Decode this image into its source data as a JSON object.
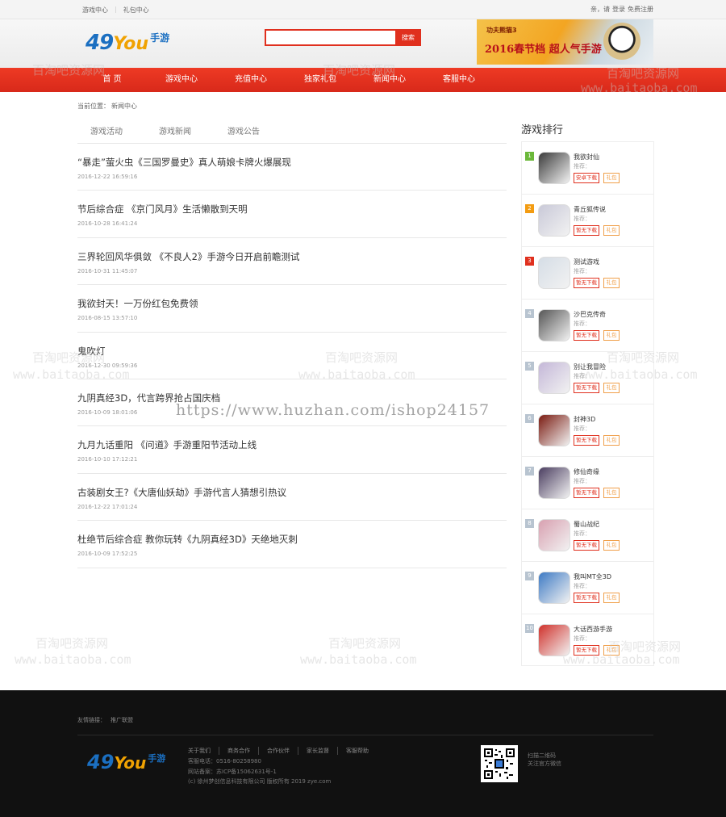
{
  "topbar": {
    "links": [
      "游戏中心",
      "礼包中心"
    ],
    "login_prefix": "亲，请",
    "login": "登录",
    "register": "免费注册"
  },
  "header": {
    "logo_num": "49",
    "logo_you": "You",
    "logo_sy": "手游",
    "search_button": "搜索",
    "banner_title": "2016春节档 超人气手游",
    "banner_sub": "功夫熊猫3"
  },
  "nav": [
    "首 页",
    "游戏中心",
    "充值中心",
    "独家礼包",
    "新闻中心",
    "客服中心"
  ],
  "watermarks": {
    "cn": "百淘吧资源网",
    "en": "www.baitaoba.com",
    "url": "https://www.huzhan.com/ishop24157"
  },
  "breadcrumb": {
    "label": "当前位置：",
    "current": "新闻中心"
  },
  "tabs": [
    "游戏活动",
    "游戏新闻",
    "游戏公告"
  ],
  "news": [
    {
      "title": "“暴走”萤火虫《三国罗曼史》真人萌娘卡牌火爆展现",
      "date": "2016-12-22 16:59:16"
    },
    {
      "title": "节后综合症 《京门风月》生活懒散到天明",
      "date": "2016-10-28 16:41:24"
    },
    {
      "title": "三界轮回风华俱敛 《不良人2》手游今日开启前瞻测试",
      "date": "2016-10-31 11:45:07"
    },
    {
      "title": "我欲封天！一万份红包免费领",
      "date": "2016-08-15 13:57:10"
    },
    {
      "title": "鬼吹灯",
      "date": "2016-12-30 09:59:36"
    },
    {
      "title": "九阴真经3D，代言跨界抢占国庆档",
      "date": "2016-10-09 18:01:06"
    },
    {
      "title": "九月九话重阳 《问道》手游重阳节活动上线",
      "date": "2016-10-10 17:12:21"
    },
    {
      "title": "古装剧女王?《大唐仙妖劫》手游代言人猜想引热议",
      "date": "2016-12-22 17:01:24"
    },
    {
      "title": "杜绝节后综合症 教你玩转《九阴真经3D》天绝地灭刺",
      "date": "2016-10-09 17:52:25"
    }
  ],
  "ranking": {
    "title": "游戏排行",
    "rec_label": "推荐：",
    "gift_label": "礼包",
    "items": [
      {
        "no": "1",
        "name": "我欲封仙",
        "btn": "安卓下载",
        "color": "#6bb83a",
        "icon_color": "#3a3a3a"
      },
      {
        "no": "2",
        "name": "青丘狐传说",
        "btn": "暂无下载",
        "color": "#f39c12",
        "icon_color": "#c9c9d8"
      },
      {
        "no": "3",
        "name": "测试游戏",
        "btn": "暂无下载",
        "color": "#e0301e",
        "icon_color": "#d5dde6"
      },
      {
        "no": "4",
        "name": "沙巴克传奇",
        "btn": "暂无下载",
        "color": "#b8c4d0",
        "icon_color": "#555555"
      },
      {
        "no": "5",
        "name": "别让我冒险",
        "btn": "暂无下载",
        "color": "#b8c4d0",
        "icon_color": "#c4b7d8"
      },
      {
        "no": "6",
        "name": "封神3D",
        "btn": "暂无下载",
        "color": "#b8c4d0",
        "icon_color": "#7a1a10"
      },
      {
        "no": "7",
        "name": "修仙奇缘",
        "btn": "暂无下载",
        "color": "#b8c4d0",
        "icon_color": "#4a3d60"
      },
      {
        "no": "8",
        "name": "蜀山战纪",
        "btn": "暂无下载",
        "color": "#b8c4d0",
        "icon_color": "#d8a0b0"
      },
      {
        "no": "9",
        "name": "我叫MT全3D",
        "btn": "暂无下载",
        "color": "#b8c4d0",
        "icon_color": "#3d7ac4"
      },
      {
        "no": "10",
        "name": "大话西游手游",
        "btn": "暂无下载",
        "color": "#b8c4d0",
        "icon_color": "#d0302a"
      }
    ]
  },
  "footer": {
    "friend_label": "友情链接：",
    "friend_link": "推广联盟",
    "links": [
      "关于我们",
      "商务合作",
      "合作伙伴",
      "家长监督",
      "客服帮助"
    ],
    "phone": "客服电话：0516-80258980",
    "icp": "网站备案：苏ICP备15062631号-1",
    "copyright": "(c) 徐州梦创信息科技有限公司 版权所有 2019 zye.com",
    "qr_text_1": "扫描二维码",
    "qr_text_2": "关注官方微信"
  }
}
